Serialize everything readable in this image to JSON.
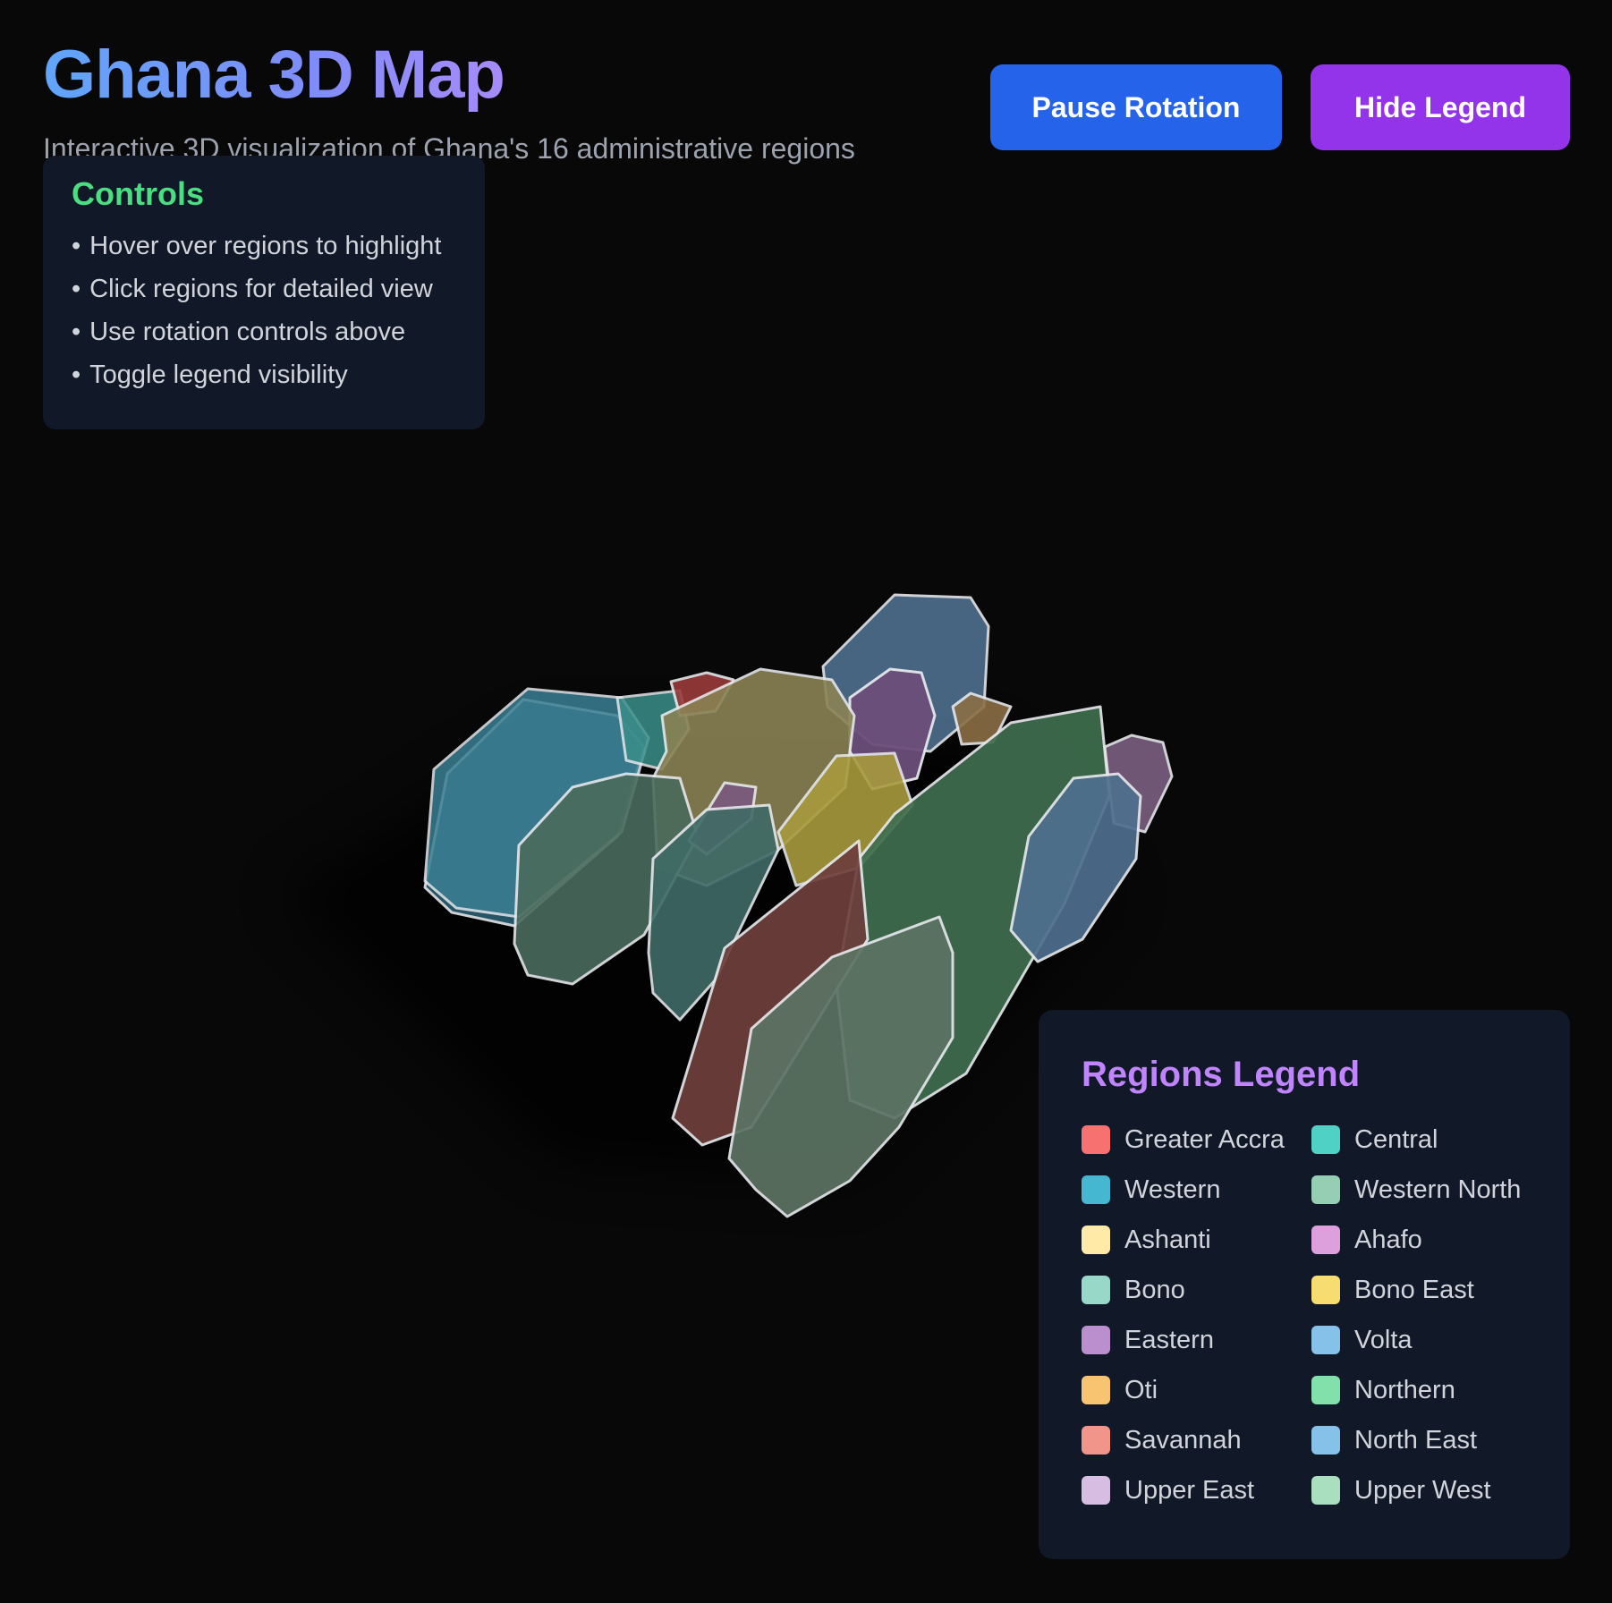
{
  "header": {
    "title": "Ghana 3D Map",
    "subtitle": "Interactive 3D visualization of Ghana's 16 administrative regions"
  },
  "toolbar": {
    "pause_label": "Pause Rotation",
    "legend_label": "Hide Legend"
  },
  "controls": {
    "title": "Controls",
    "items": [
      "Hover over regions to highlight",
      "Click regions for detailed view",
      "Use rotation controls above",
      "Toggle legend visibility"
    ]
  },
  "legend": {
    "title": "Regions Legend",
    "regions": [
      {
        "name": "Greater Accra",
        "color": "#f87171"
      },
      {
        "name": "Central",
        "color": "#4fd1c5"
      },
      {
        "name": "Western",
        "color": "#45b7d1"
      },
      {
        "name": "Western North",
        "color": "#96ceb4"
      },
      {
        "name": "Ashanti",
        "color": "#ffeaa7"
      },
      {
        "name": "Ahafo",
        "color": "#dda0dd"
      },
      {
        "name": "Bono",
        "color": "#98d8c8"
      },
      {
        "name": "Bono East",
        "color": "#f7dc6f"
      },
      {
        "name": "Eastern",
        "color": "#bb8fce"
      },
      {
        "name": "Volta",
        "color": "#85c1e9"
      },
      {
        "name": "Oti",
        "color": "#f8c471"
      },
      {
        "name": "Northern",
        "color": "#82e0aa"
      },
      {
        "name": "Savannah",
        "color": "#f1948a"
      },
      {
        "name": "North East",
        "color": "#85c1e9"
      },
      {
        "name": "Upper East",
        "color": "#d7bde2"
      },
      {
        "name": "Upper West",
        "color": "#a9dfbf"
      }
    ]
  }
}
